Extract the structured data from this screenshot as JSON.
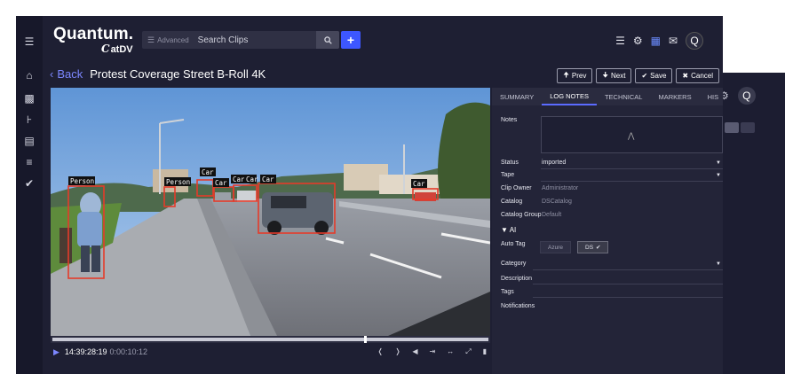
{
  "app": {
    "brand_title": "Quantum.",
    "brand_sub_mark": "C",
    "brand_sub": "atDV"
  },
  "search": {
    "advanced_label": "Advanced",
    "placeholder": "Search Clips",
    "add_label": "+"
  },
  "topbar_icons": [
    "menu-icon",
    "gear-icon",
    "calendar-icon",
    "chat-icon"
  ],
  "user": {
    "avatar_initial": "Q"
  },
  "clip": {
    "back_label": "Back",
    "title": "Protest Coverage Street B-Roll 4K"
  },
  "actions": {
    "prev": "Prev",
    "next": "Next",
    "save": "Save",
    "cancel": "Cancel"
  },
  "video_labels": {
    "person1": "Person",
    "person2": "Person",
    "car1": "Car",
    "car2": "Car",
    "car3": "Car",
    "car4": "Car",
    "car5": "Car",
    "car6": "Car"
  },
  "player": {
    "timecode": "14:39:28:19",
    "position": "0:00:10:12"
  },
  "tabs": [
    "SUMMARY",
    "LOG NOTES",
    "TECHNICAL",
    "MARKERS",
    "HIS"
  ],
  "active_tab": "LOG NOTES",
  "fields": {
    "notes_label": "Notes",
    "status_label": "Status",
    "status_value": "imported",
    "tape_label": "Tape",
    "clip_owner_label": "Clip Owner",
    "clip_owner_value": "Administrator",
    "catalog_label": "Catalog",
    "catalog_value": "DSCatalog",
    "catalog_group_label": "Catalog Group",
    "catalog_group_value": "Default",
    "ai_heading": "AI",
    "auto_tag_label": "Auto Tag",
    "azure_label": "Azure",
    "ds_label": "DS",
    "category_label": "Category",
    "description_label": "Description",
    "tags_label": "Tags",
    "notifications_label": "Notifications"
  },
  "background_window": {
    "avatar_initial": "Q"
  },
  "colors": {
    "window_bg": "#1e1f33",
    "accent": "#3d57ff",
    "link": "#7c87ff",
    "detection_box": "#e53b2a"
  }
}
